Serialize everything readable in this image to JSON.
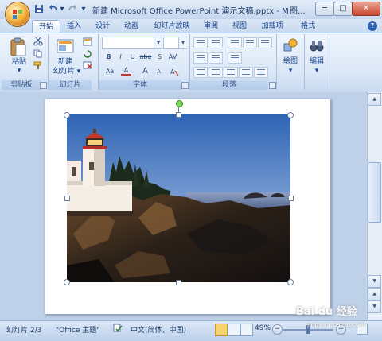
{
  "window": {
    "title": "新建 Microsoft Office PowerPoint 演示文稿.pptx - Mi...",
    "title_extra": "图...",
    "minimize_glyph": "─",
    "maximize_glyph": "□",
    "close_glyph": "✕"
  },
  "quick_access": {
    "save_icon": "save-icon",
    "undo_icon": "undo-icon",
    "redo_icon": "redo-icon",
    "customize_icon": "chevron-down-icon"
  },
  "ribbon_tabs": [
    {
      "label": "开始",
      "active": true
    },
    {
      "label": "插入"
    },
    {
      "label": "设计"
    },
    {
      "label": "动画"
    },
    {
      "label": "幻灯片放映"
    },
    {
      "label": "审阅"
    },
    {
      "label": "视图"
    },
    {
      "label": "加载项"
    },
    {
      "label": "格式"
    }
  ],
  "help_glyph": "?",
  "groups": {
    "clipboard": {
      "label": "剪贴板",
      "paste_label": "粘贴",
      "paste_arrow": "▾"
    },
    "slides": {
      "label": "幻灯片",
      "new_slide_label_1": "新建",
      "new_slide_label_2": "幻灯片 ▾"
    },
    "font": {
      "label": "字体",
      "bold": "B",
      "italic": "I",
      "underline": "U",
      "strike": "abe",
      "shadow": "S",
      "spacing": "AV",
      "case": "Aa",
      "color": "A",
      "grow": "A",
      "shrink": "A"
    },
    "paragraph": {
      "label": "段落"
    },
    "drawing": {
      "label": "绘图",
      "arrow": "▾"
    },
    "editing": {
      "label": "编辑",
      "arrow": "▾"
    }
  },
  "status_bar": {
    "slide_indicator": "幻灯片 2/3",
    "theme": "\"Office 主题\"",
    "language": "中文(简体，中国)",
    "zoom": "49%",
    "zoom_out": "−",
    "zoom_in": "+"
  },
  "watermark": {
    "brand": "Bai du 经验",
    "url": "jingyan.baidu.com"
  },
  "colors": {
    "accent": "#15428b",
    "ribbon": "#dce8f7",
    "workspace": "#bfd1e8"
  }
}
